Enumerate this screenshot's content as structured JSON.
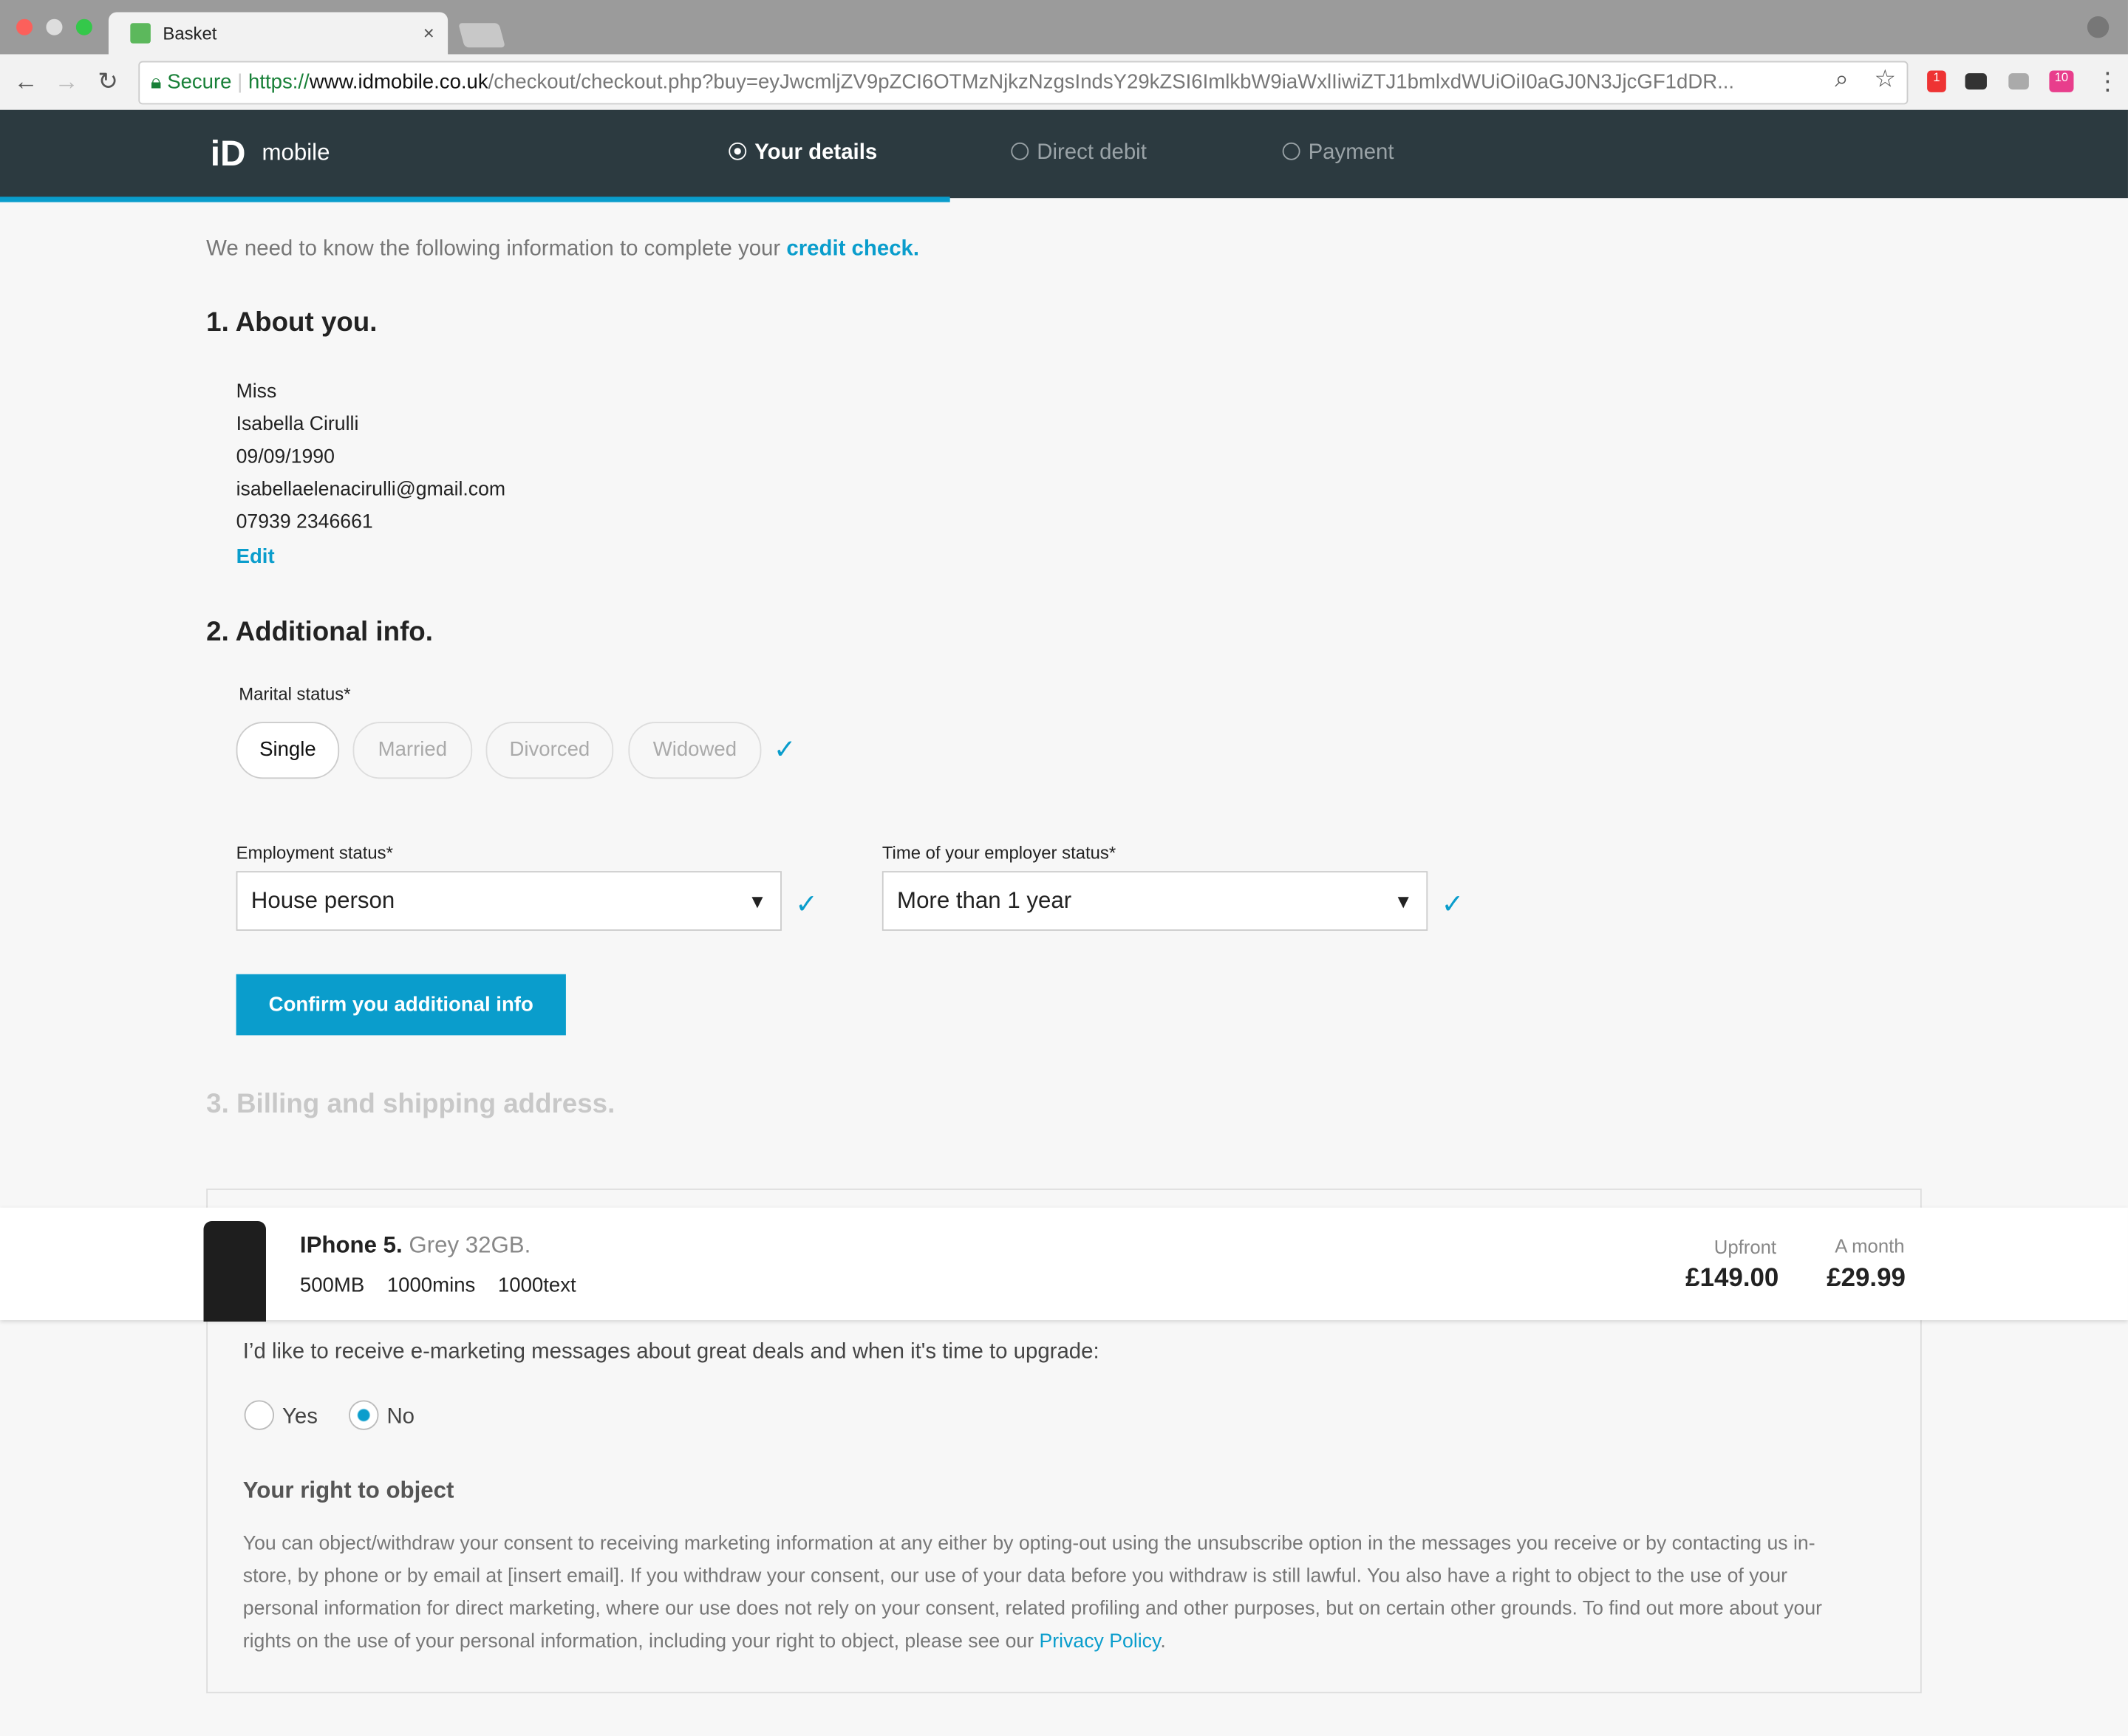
{
  "browser": {
    "tab_title": "Basket",
    "url_secure": "Secure",
    "url_scheme": "https://",
    "url_host": "www.idmobile.co.uk",
    "url_path": "/checkout/checkout.php?buy=eyJwcmljZV9pZCI6OTMzNjkzNzgsIndsY29kZSI6ImlkbW9iaWxlIiwiZTJ1bmlxdWUiOiI0aGJ0N3JjcGF1dDR...",
    "extension_badges": [
      "1",
      "10"
    ]
  },
  "header": {
    "logo": "mobile",
    "steps": [
      {
        "label": "Your details",
        "active": true
      },
      {
        "label": "Direct debit",
        "active": false
      },
      {
        "label": "Payment",
        "active": false
      }
    ],
    "progress_percent": 45
  },
  "intro": {
    "text": "We need to know the following information to complete your ",
    "link": "credit check."
  },
  "about": {
    "title": "1. About you.",
    "lines": [
      "Miss",
      "Isabella Cirulli",
      "09/09/1990",
      "isabellaelenacirulli@gmail.com",
      "07939 2346661"
    ],
    "edit": "Edit"
  },
  "additional": {
    "title": "2. Additional info.",
    "marital_label": "Marital status*",
    "marital_options": [
      "Single",
      "Married",
      "Divorced",
      "Widowed"
    ],
    "marital_selected": "Single",
    "employment_label": "Employment status*",
    "employment_value": "House person",
    "time_label": "Time of your employer status*",
    "time_value": "More than 1 year",
    "confirm": "Confirm you additional info"
  },
  "billing": {
    "title": "3. Billing and shipping address."
  },
  "product": {
    "name": "IPhone 5.",
    "variant": "Grey 32GB.",
    "data": "500MB",
    "mins": "1000mins",
    "texts": "1000text",
    "upfront_label": "Upfront",
    "upfront": "£149.00",
    "month_label": "A month",
    "month": "£29.99"
  },
  "marketing": {
    "question": "I’d like to receive e-marketing messages about great deals and when it's time to upgrade:",
    "yes": "Yes",
    "no": "No",
    "selected": "No",
    "right_title": "Your right to object",
    "right_text": "You can object/withdraw your consent to receiving marketing information at any either by opting-out using the unsubscribe option in the messages you receive or by contacting us in-store, by phone or by email at [insert email]. If you withdraw your consent, our use of your data before you withdraw is still lawful. You also have a right to object to the use of your personal information for direct marketing, where our use does not rely on your consent, related profiling and other purposes, but on certain other grounds. To find out more about your rights on the use of your personal information, including your right to object, please see our ",
    "privacy_link": "Privacy Policy",
    "end": "."
  },
  "colors": {
    "accent": "#0a9dcc",
    "header_bg": "#2c3a40"
  }
}
